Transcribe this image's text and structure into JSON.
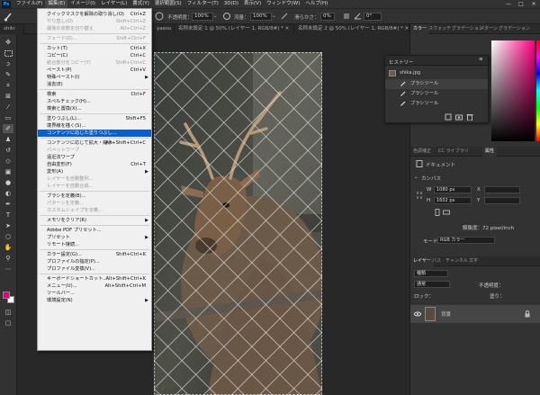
{
  "menubar": {
    "logo": "Ps",
    "items": [
      "ファイル(F)",
      "編集(E)",
      "イメージ(I)",
      "レイヤー(L)",
      "書式(Y)",
      "選択範囲(S)",
      "フィルター(T)",
      "3D(D)",
      "表示(V)",
      "ウィンドウ(W)",
      "ヘルプ(H)"
    ],
    "active_index": 1,
    "window_controls": [
      "—",
      "□",
      "✕"
    ]
  },
  "options_bar": {
    "opacity_label": "不透明度：",
    "opacity_value": "100%",
    "flow_label": "流量：",
    "flow_value": "100%",
    "smoothing_label": "滑らかさ：",
    "smoothing_value": "0%",
    "angle_value": "0°"
  },
  "tabs": [
    {
      "label": "shiki",
      "active": false
    },
    {
      "label": "yaesu",
      "active": false
    },
    {
      "label": "名称未設定 1 @ 50% (レイヤー 1, RGB/8#) *",
      "active": false
    },
    {
      "label": "名称未設定 2 @ 50% (レイヤー 1, RGB/8#) *",
      "active": false
    }
  ],
  "edit_menu": [
    {
      "label": "クイックマスクを解除の取り消し(O)",
      "shortcut": "Ctrl+Z",
      "disabled": false
    },
    {
      "label": "やり直し(O)",
      "shortcut": "Shift+Ctrl+Z",
      "disabled": true
    },
    {
      "label": "最後の状態を切り替え",
      "shortcut": "Alt+Ctrl+Z",
      "disabled": true
    },
    {
      "sep": true
    },
    {
      "label": "フェード(D)...",
      "shortcut": "Shift+Ctrl+F",
      "disabled": true
    },
    {
      "sep": true
    },
    {
      "label": "カット(T)",
      "shortcut": "Ctrl+X",
      "disabled": false
    },
    {
      "label": "コピー(C)",
      "shortcut": "Ctrl+C",
      "disabled": false
    },
    {
      "label": "結合部分をコピー(Y)",
      "shortcut": "Shift+Ctrl+C",
      "disabled": true
    },
    {
      "label": "ペースト(P)",
      "shortcut": "Ctrl+V",
      "disabled": false
    },
    {
      "label": "特殊ペースト(I)",
      "shortcut": "",
      "disabled": false,
      "submenu": true
    },
    {
      "label": "消去(E)",
      "shortcut": "",
      "disabled": false
    },
    {
      "sep": true
    },
    {
      "label": "検索",
      "shortcut": "Ctrl+F",
      "disabled": false
    },
    {
      "label": "スペルチェック(H)...",
      "shortcut": "",
      "disabled": false
    },
    {
      "label": "検索と置換(X)...",
      "shortcut": "",
      "disabled": false
    },
    {
      "sep": true
    },
    {
      "label": "塗りつぶし(L)...",
      "shortcut": "Shift+F5",
      "disabled": false
    },
    {
      "label": "境界線を描く(S)...",
      "shortcut": "",
      "disabled": false
    },
    {
      "label": "コンテンツに応じた塗りつぶし...",
      "shortcut": "",
      "disabled": false,
      "highlight": true
    },
    {
      "sep": true
    },
    {
      "label": "コンテンツに応じて拡大・縮小",
      "shortcut": "Alt+Shift+Ctrl+C",
      "disabled": false
    },
    {
      "label": "パペットワープ",
      "shortcut": "",
      "disabled": true
    },
    {
      "label": "遠近法ワープ",
      "shortcut": "",
      "disabled": false
    },
    {
      "label": "自由変形(F)",
      "shortcut": "Ctrl+T",
      "disabled": false
    },
    {
      "label": "変形(A)",
      "shortcut": "",
      "disabled": false,
      "submenu": true
    },
    {
      "label": "レイヤーを自動整列...",
      "shortcut": "",
      "disabled": true
    },
    {
      "label": "レイヤーを自動合成...",
      "shortcut": "",
      "disabled": true
    },
    {
      "sep": true
    },
    {
      "label": "ブラシを定義(B)...",
      "shortcut": "",
      "disabled": false
    },
    {
      "label": "パターンを定義...",
      "shortcut": "",
      "disabled": true
    },
    {
      "label": "カスタムシェイプを定義...",
      "shortcut": "",
      "disabled": true
    },
    {
      "sep": true
    },
    {
      "label": "メモリをクリア(R)",
      "shortcut": "",
      "disabled": false,
      "submenu": true
    },
    {
      "sep": true
    },
    {
      "label": "Adobe PDF プリセット...",
      "shortcut": "",
      "disabled": false
    },
    {
      "label": "プリセット",
      "shortcut": "",
      "disabled": false,
      "submenu": true
    },
    {
      "label": "リモート接続...",
      "shortcut": "",
      "disabled": false
    },
    {
      "sep": true
    },
    {
      "label": "カラー設定(G)...",
      "shortcut": "Shift+Ctrl+K",
      "disabled": false
    },
    {
      "label": "プロファイルの指定(P)...",
      "shortcut": "",
      "disabled": false
    },
    {
      "label": "プロファイル変換(V)...",
      "shortcut": "",
      "disabled": false
    },
    {
      "sep": true
    },
    {
      "label": "キーボードショートカット...",
      "shortcut": "Alt+Shift+Ctrl+K",
      "disabled": false
    },
    {
      "label": "メニュー(U)...",
      "shortcut": "Alt+Shift+Ctrl+M",
      "disabled": false
    },
    {
      "label": "ツールバー...",
      "shortcut": "",
      "disabled": false
    },
    {
      "label": "環境設定(N)",
      "shortcut": "",
      "disabled": false,
      "submenu": true
    }
  ],
  "color_panel": {
    "tabs": [
      "カラー",
      "スウォッチ",
      "グラデーション",
      "パターン",
      "グラデーション"
    ],
    "accent": "#ff0080"
  },
  "history_panel": {
    "title": "ヒストリー",
    "snapshot": "shika.jpg",
    "items": [
      "ブラシツール",
      "ブラシツール",
      "ブラシツール"
    ]
  },
  "properties_panel": {
    "tabs": [
      "色調補正",
      "CC ライブラリ",
      "属性"
    ],
    "doc_label": "ドキュメント",
    "section": "カンバス",
    "w_label": "W",
    "w_value": "1080 px",
    "h_label": "H",
    "h_value": "1602 px",
    "x_label": "X",
    "y_label": "Y",
    "resolution": "解像度：72 pixel/inch",
    "mode_label": "モード",
    "mode_value": "RGB カラー"
  },
  "layers_panel": {
    "tabs": [
      "レイヤー",
      "パス",
      "チャンネル",
      "文字"
    ],
    "kind_label": "種類",
    "blend_mode": "通常",
    "opacity_label": "不透明度：",
    "lock_label": "ロック：",
    "fill_label": "塗り：",
    "layer_name": "背景"
  },
  "tools": [
    "move-tool",
    "marquee-tool",
    "lasso-tool",
    "quick-select-tool",
    "crop-tool",
    "frame-tool",
    "eyedropper-tool",
    "healing-tool",
    "brush-tool",
    "stamp-tool",
    "history-brush-tool",
    "eraser-tool",
    "gradient-tool",
    "blur-tool",
    "dodge-tool",
    "pen-tool",
    "type-tool",
    "path-select-tool",
    "shape-tool",
    "hand-tool",
    "zoom-tool",
    "more-tools"
  ],
  "colors": {
    "foreground": "#e6007e",
    "background": "#ffffff",
    "menu_highlight": "#0a5fcc"
  }
}
